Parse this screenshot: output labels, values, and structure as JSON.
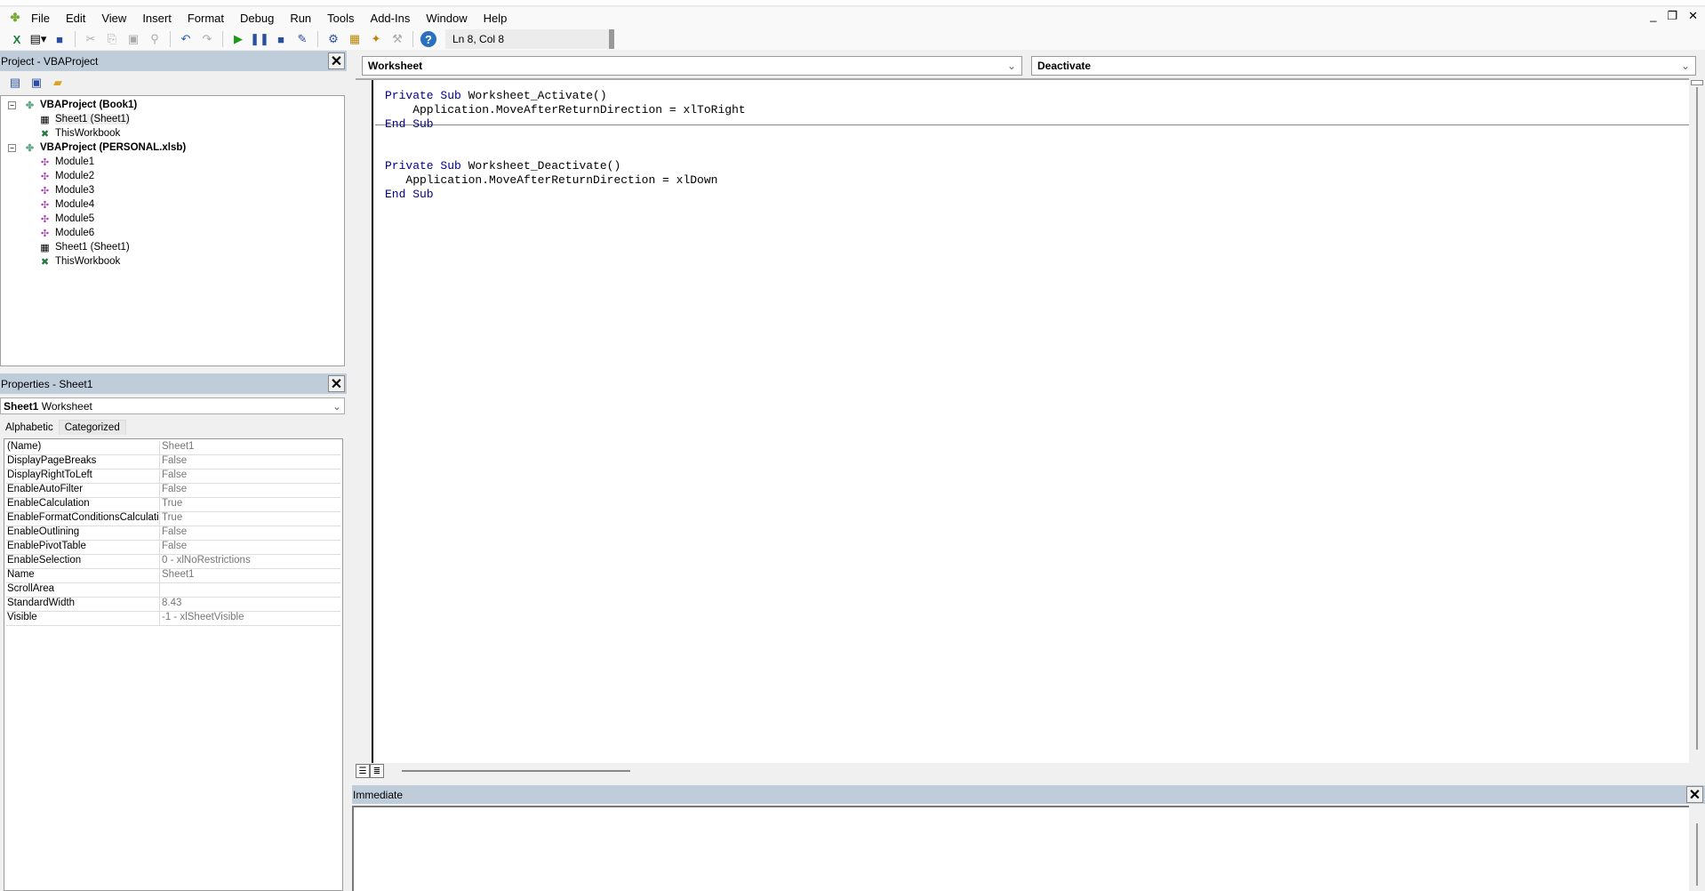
{
  "menubar": {
    "items": [
      {
        "label": "File",
        "u": "F"
      },
      {
        "label": "Edit",
        "u": "E"
      },
      {
        "label": "View",
        "u": "V"
      },
      {
        "label": "Insert",
        "u": "I"
      },
      {
        "label": "Format",
        "u": "o"
      },
      {
        "label": "Debug",
        "u": "D"
      },
      {
        "label": "Run",
        "u": "R"
      },
      {
        "label": "Tools",
        "u": "T"
      },
      {
        "label": "Add-Ins",
        "u": "A"
      },
      {
        "label": "Window",
        "u": "W"
      },
      {
        "label": "Help",
        "u": "H"
      }
    ]
  },
  "toolbar": {
    "position": "Ln 8, Col 8"
  },
  "project": {
    "title": "Project - VBAProject",
    "tree": [
      {
        "label": "VBAProject (Book1)",
        "level": 0,
        "type": "project"
      },
      {
        "label": "Sheet1 (Sheet1)",
        "level": 1,
        "type": "sheet"
      },
      {
        "label": "ThisWorkbook",
        "level": 1,
        "type": "workbook"
      },
      {
        "label": "VBAProject (PERSONAL.xlsb)",
        "level": 0,
        "type": "project"
      },
      {
        "label": "Module1",
        "level": 1,
        "type": "module"
      },
      {
        "label": "Module2",
        "level": 1,
        "type": "module"
      },
      {
        "label": "Module3",
        "level": 1,
        "type": "module"
      },
      {
        "label": "Module4",
        "level": 1,
        "type": "module"
      },
      {
        "label": "Module5",
        "level": 1,
        "type": "module"
      },
      {
        "label": "Module6",
        "level": 1,
        "type": "module"
      },
      {
        "label": "Sheet1 (Sheet1)",
        "level": 1,
        "type": "sheet"
      },
      {
        "label": "ThisWorkbook",
        "level": 1,
        "type": "workbook"
      }
    ]
  },
  "properties": {
    "title": "Properties - Sheet1",
    "object_name": "Sheet1",
    "object_type": "Worksheet",
    "tabs": [
      "Alphabetic",
      "Categorized"
    ],
    "rows": [
      {
        "k": "(Name)",
        "v": "Sheet1"
      },
      {
        "k": "DisplayPageBreaks",
        "v": "False"
      },
      {
        "k": "DisplayRightToLeft",
        "v": "False"
      },
      {
        "k": "EnableAutoFilter",
        "v": "False"
      },
      {
        "k": "EnableCalculation",
        "v": "True"
      },
      {
        "k": "EnableFormatConditionsCalculation",
        "v": "True"
      },
      {
        "k": "EnableOutlining",
        "v": "False"
      },
      {
        "k": "EnablePivotTable",
        "v": "False"
      },
      {
        "k": "EnableSelection",
        "v": "0 - xlNoRestrictions"
      },
      {
        "k": "Name",
        "v": "Sheet1"
      },
      {
        "k": "ScrollArea",
        "v": ""
      },
      {
        "k": "StandardWidth",
        "v": "8.43"
      },
      {
        "k": "Visible",
        "v": "-1 - xlSheetVisible"
      }
    ]
  },
  "code": {
    "object": "Worksheet",
    "procedure": "Deactivate",
    "lines": [
      {
        "kw1": "Private Sub",
        "rest": " Worksheet_Activate()"
      },
      {
        "kw1": "",
        "rest": "    Application.MoveAfterReturnDirection = xlToRight"
      },
      {
        "kw1": "End Sub",
        "rest": ""
      },
      {
        "kw1": "Private Sub",
        "rest": " Worksheet_Deactivate()"
      },
      {
        "kw1": "",
        "rest": "   Application.MoveAfterReturnDirection = xlDown"
      },
      {
        "kw1": "End Sub",
        "rest": ""
      }
    ]
  },
  "immediate": {
    "title": "Immediate"
  },
  "colors": {
    "pane_header": "#bfcddb",
    "keyword": "#00008b"
  }
}
